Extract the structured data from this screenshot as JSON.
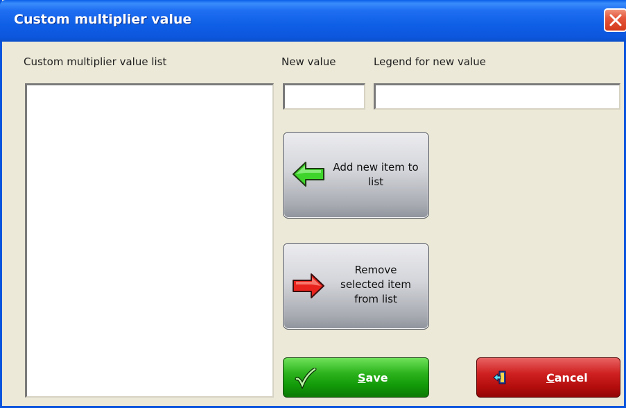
{
  "window": {
    "title": "Custom multiplier value"
  },
  "labels": {
    "list": "Custom multiplier value list",
    "new_value": "New value",
    "legend": "Legend for new value"
  },
  "inputs": {
    "new_value": "",
    "legend": ""
  },
  "list_items": [],
  "buttons": {
    "add": {
      "line1": "Add new item to",
      "line2": "list",
      "icon": "green-left-arrow-icon"
    },
    "remove": {
      "line1": "Remove",
      "line2": "selected item",
      "line3": "from list",
      "icon": "red-right-arrow-icon"
    },
    "save": {
      "accel": "S",
      "rest": "ave",
      "icon": "checkmark-icon"
    },
    "cancel": {
      "accel": "C",
      "rest": "ancel",
      "icon": "exit-door-icon"
    }
  },
  "colors": {
    "title_bar": "#0c56dc",
    "dialog_bg": "#ece9d8",
    "save": "#139a09",
    "cancel": "#cf2020"
  }
}
